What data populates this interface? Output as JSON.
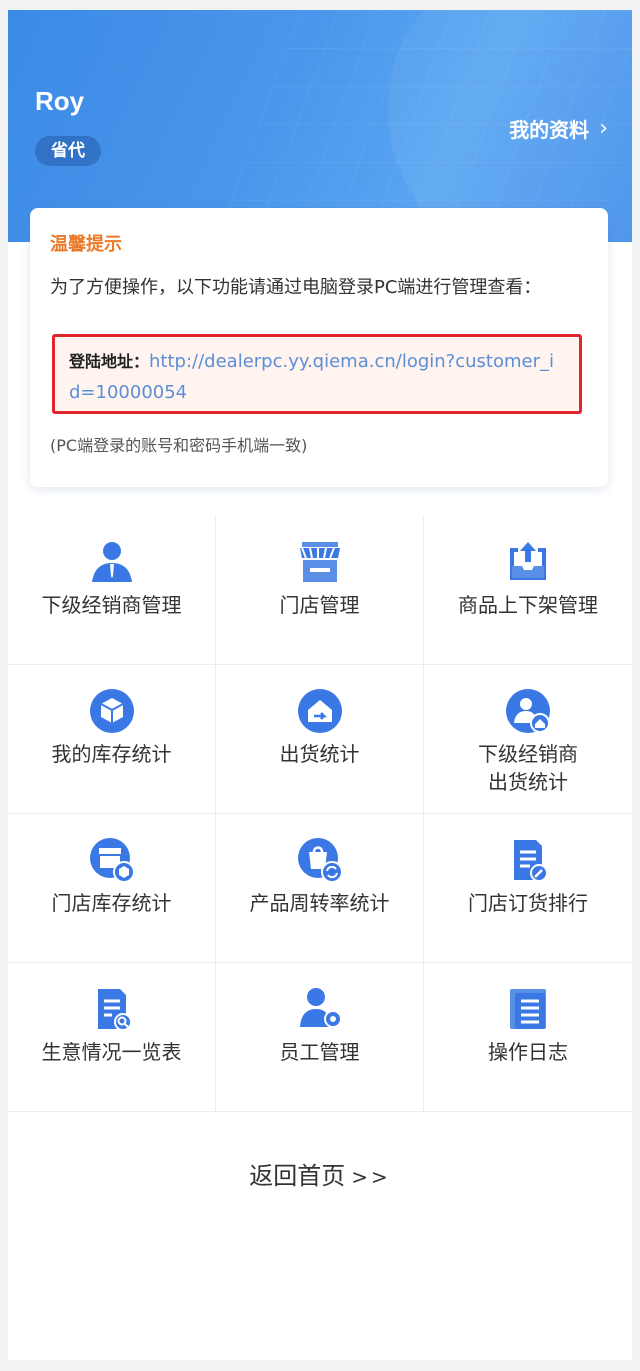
{
  "header": {
    "username": "Roy",
    "role": "省代",
    "profile_link": "我的资料",
    "profile_chevron": "›"
  },
  "tip": {
    "title": "温馨提示",
    "body": "为了方便操作，以下功能请通过电脑登录PC端进行管理查看：",
    "login_label": "登陆地址：",
    "login_url": "http://dealerpc.yy.qiema.cn/login?customer_id=10000054",
    "note": "(PC端登录的账号和密码手机端一致)"
  },
  "menu": [
    {
      "label": "下级经销商管理",
      "icon": "subordinate-dealer-icon"
    },
    {
      "label": "门店管理",
      "icon": "store-icon"
    },
    {
      "label": "商品上下架管理",
      "icon": "product-shelf-icon"
    },
    {
      "label": "我的库存统计",
      "icon": "inventory-box-icon"
    },
    {
      "label": "出货统计",
      "icon": "shipment-icon"
    },
    {
      "label": "下级经销商\n出货统计",
      "icon": "dealer-shipment-icon"
    },
    {
      "label": "门店库存统计",
      "icon": "store-inventory-icon"
    },
    {
      "label": "产品周转率统计",
      "icon": "turnover-icon"
    },
    {
      "label": "门店订货排行",
      "icon": "order-ranking-icon"
    },
    {
      "label": "生意情况一览表",
      "icon": "business-report-icon"
    },
    {
      "label": "员工管理",
      "icon": "staff-icon"
    },
    {
      "label": "操作日志",
      "icon": "operation-log-icon"
    }
  ],
  "footer": {
    "back_home": "返回首页",
    "arrows": ">>"
  },
  "colors": {
    "header_blue": "#4690ea",
    "icon_blue": "#3a78e6",
    "tip_orange": "#ea7a2b",
    "highlight_red": "#e0262a",
    "link_blue": "#5b8ed6"
  }
}
